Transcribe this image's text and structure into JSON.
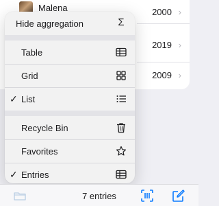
{
  "list": {
    "rows": [
      {
        "name": "Malena",
        "year": "2000"
      },
      {
        "name": "",
        "year": "2019"
      },
      {
        "name": "",
        "year": "2009"
      }
    ]
  },
  "menu": {
    "hide_aggregation": "Hide aggregation",
    "table": "Table",
    "grid": "Grid",
    "list": "List",
    "recycle_bin": "Recycle Bin",
    "favorites": "Favorites",
    "entries": "Entries",
    "checkmark": "✓",
    "sigma": "Σ"
  },
  "toolbar": {
    "count": "7 entries"
  },
  "colors": {
    "accent": "#0a7aff",
    "menu_bg": "#f2f2f2",
    "background": "#efeff4"
  }
}
